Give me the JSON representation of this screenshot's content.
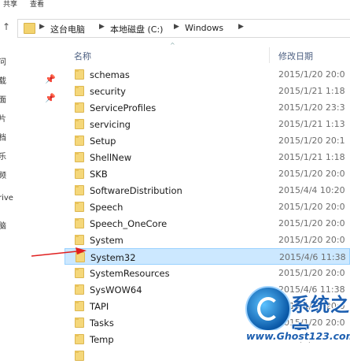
{
  "ribbon": {
    "tabs": [
      "共享",
      "查看"
    ]
  },
  "address_bar": {
    "crumbs": [
      "这台电脑",
      "本地磁盘 (C:)",
      "Windows"
    ]
  },
  "nav_pane": {
    "items": [
      "问",
      "载",
      "面",
      "片",
      "档",
      "乐",
      "频",
      "rive",
      "脑"
    ]
  },
  "columns": {
    "name": "名称",
    "date": "修改日期"
  },
  "files": [
    {
      "name": "schemas",
      "date": "2015/1/20 20:0",
      "selected": false
    },
    {
      "name": "security",
      "date": "2015/1/21 1:18",
      "selected": false
    },
    {
      "name": "ServiceProfiles",
      "date": "2015/1/20 23:3",
      "selected": false
    },
    {
      "name": "servicing",
      "date": "2015/1/21 1:13",
      "selected": false
    },
    {
      "name": "Setup",
      "date": "2015/1/20 20:1",
      "selected": false
    },
    {
      "name": "ShellNew",
      "date": "2015/1/21 1:18",
      "selected": false
    },
    {
      "name": "SKB",
      "date": "2015/1/20 20:0",
      "selected": false
    },
    {
      "name": "SoftwareDistribution",
      "date": "2015/4/4 10:20",
      "selected": false
    },
    {
      "name": "Speech",
      "date": "2015/1/20 20:0",
      "selected": false
    },
    {
      "name": "Speech_OneCore",
      "date": "2015/1/20 20:0",
      "selected": false
    },
    {
      "name": "System",
      "date": "2015/1/20 20:0",
      "selected": false
    },
    {
      "name": "System32",
      "date": "2015/4/6 11:38",
      "selected": true
    },
    {
      "name": "SystemResources",
      "date": "2015/1/20 20:0",
      "selected": false
    },
    {
      "name": "SysWOW64",
      "date": "2015/4/6 11:38",
      "selected": false
    },
    {
      "name": "TAPI",
      "date": "2015/1/20 20:0",
      "selected": false
    },
    {
      "name": "Tasks",
      "date": "2015/1/20 20:0",
      "selected": false
    },
    {
      "name": "Temp",
      "date": "2015/1/20 20:0",
      "selected": false
    },
    {
      "name": "",
      "date": "",
      "selected": false
    }
  ],
  "watermark": {
    "title": "系统之家",
    "url": "www.Ghost123.com"
  },
  "colors": {
    "selection_bg": "#cce8ff",
    "selection_border": "#99d1ff",
    "folder": "#f5d77a",
    "annotation_arrow": "#e02020"
  }
}
